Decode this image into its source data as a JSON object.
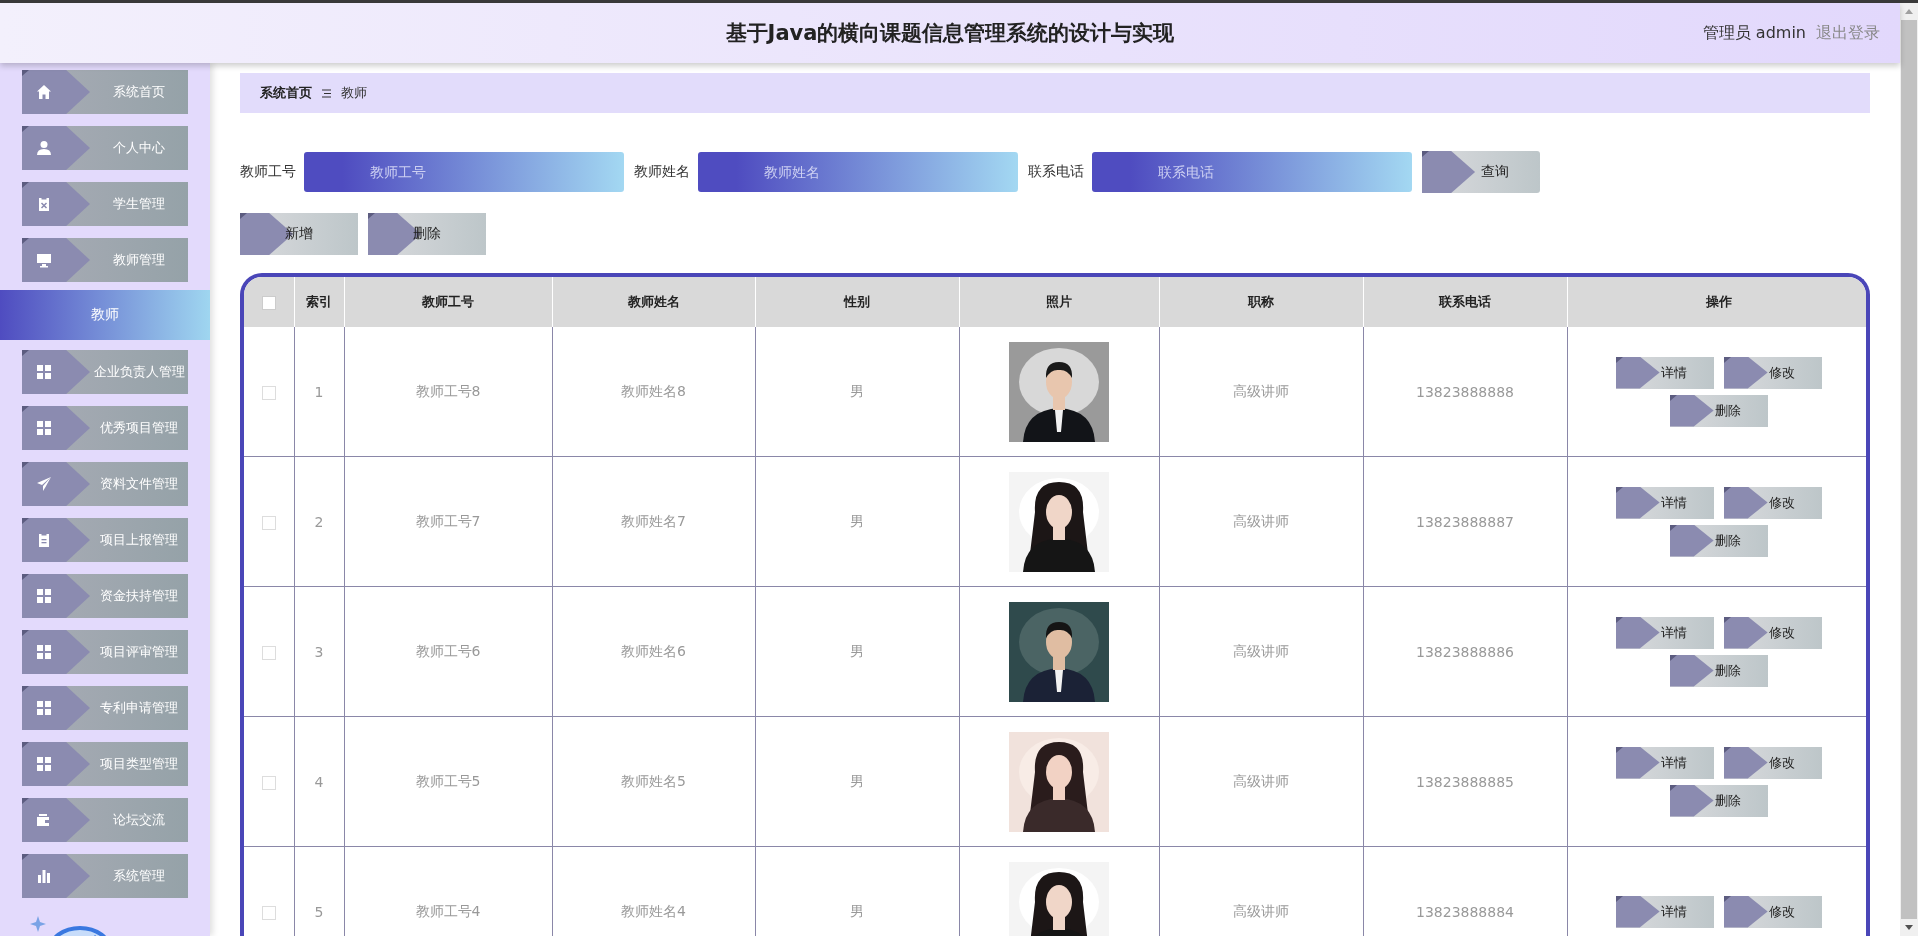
{
  "header": {
    "title": "基于Java的横向课题信息管理系统的设计与实现",
    "user": "管理员 admin",
    "logout": "退出登录"
  },
  "sidebar": {
    "items": [
      {
        "label": "系统首页",
        "selected": false
      },
      {
        "label": "个人中心",
        "selected": false
      },
      {
        "label": "学生管理",
        "selected": false
      },
      {
        "label": "教师管理",
        "selected": false,
        "children": [
          {
            "label": "教师",
            "selected": true
          }
        ]
      },
      {
        "label": "企业负责人管理",
        "selected": false
      },
      {
        "label": "优秀项目管理",
        "selected": false
      },
      {
        "label": "资料文件管理",
        "selected": false
      },
      {
        "label": "项目上报管理",
        "selected": false
      },
      {
        "label": "资金扶持管理",
        "selected": false
      },
      {
        "label": "项目评审管理",
        "selected": false
      },
      {
        "label": "专利申请管理",
        "selected": false
      },
      {
        "label": "项目类型管理",
        "selected": false
      },
      {
        "label": "论坛交流",
        "selected": false
      },
      {
        "label": "系统管理",
        "selected": false
      }
    ]
  },
  "breadcrumb": [
    "系统首页",
    "教师"
  ],
  "search": {
    "fields": [
      {
        "label": "教师工号",
        "placeholder": "教师工号"
      },
      {
        "label": "教师姓名",
        "placeholder": "教师姓名"
      },
      {
        "label": "联系电话",
        "placeholder": "联系电话"
      }
    ],
    "button": "查询"
  },
  "actions": [
    "新增",
    "删除"
  ],
  "table": {
    "select_all": {
      "checked": false
    },
    "columns": [
      "索引",
      "教师工号",
      "教师姓名",
      "性别",
      "照片",
      "职称",
      "联系电话",
      "操作"
    ],
    "rows": [
      {
        "checked": false,
        "cells": [
          "1",
          "教师工号8",
          "教师姓名8",
          "男",
          "",
          "高级讲师",
          "13823888888"
        ],
        "actions": [
          "详情",
          "修改",
          "删除"
        ]
      },
      {
        "checked": false,
        "cells": [
          "2",
          "教师工号7",
          "教师姓名7",
          "男",
          "",
          "高级讲师",
          "13823888887"
        ],
        "actions": [
          "详情",
          "修改",
          "删除"
        ]
      },
      {
        "checked": false,
        "cells": [
          "3",
          "教师工号6",
          "教师姓名6",
          "男",
          "",
          "高级讲师",
          "13823888886"
        ],
        "actions": [
          "详情",
          "修改",
          "删除"
        ]
      },
      {
        "checked": false,
        "cells": [
          "4",
          "教师工号5",
          "教师姓名5",
          "男",
          "",
          "高级讲师",
          "13823888885"
        ],
        "actions": [
          "详情",
          "修改",
          "删除"
        ]
      },
      {
        "checked": false,
        "cells": [
          "5",
          "教师工号4",
          "教师姓名4",
          "男",
          "",
          "高级讲师",
          "13823888884"
        ],
        "actions": [
          "详情",
          "修改"
        ]
      }
    ]
  }
}
